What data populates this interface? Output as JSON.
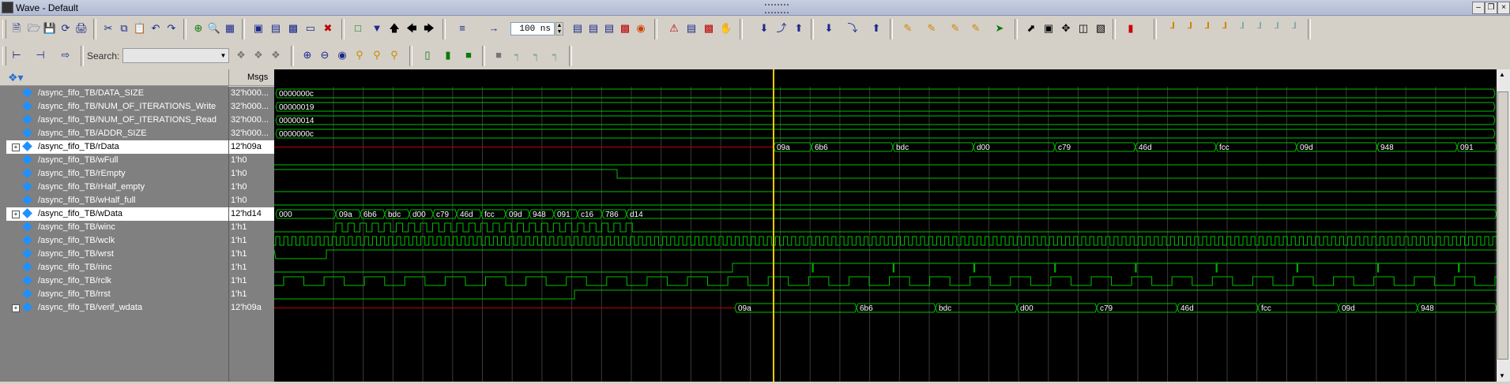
{
  "window": {
    "title": "Wave - Default"
  },
  "toolbar": {
    "zoom_value": "100 ns",
    "search_label": "Search:",
    "search_value": ""
  },
  "pane": {
    "msgs_header": "Msgs"
  },
  "colors": {
    "wave": "#00c000",
    "bus_invalid": "#c00000",
    "cursor": "#ffcc00",
    "highlight": "#ffffff"
  },
  "signals": [
    {
      "name": "/async_fifo_TB/DATA_SIZE",
      "value": "32'h000...",
      "expand": false,
      "highlight": false
    },
    {
      "name": "/async_fifo_TB/NUM_OF_ITERATIONS_Write",
      "value": "32'h000...",
      "expand": false,
      "highlight": false
    },
    {
      "name": "/async_fifo_TB/NUM_OF_ITERATIONS_Read",
      "value": "32'h000...",
      "expand": false,
      "highlight": false
    },
    {
      "name": "/async_fifo_TB/ADDR_SIZE",
      "value": "32'h000...",
      "expand": false,
      "highlight": false
    },
    {
      "name": "/async_fifo_TB/rData",
      "value": "12'h09a",
      "expand": true,
      "highlight": true
    },
    {
      "name": "/async_fifo_TB/wFull",
      "value": "1'h0",
      "expand": false,
      "highlight": false
    },
    {
      "name": "/async_fifo_TB/rEmpty",
      "value": "1'h0",
      "expand": false,
      "highlight": false
    },
    {
      "name": "/async_fifo_TB/rHalf_empty",
      "value": "1'h0",
      "expand": false,
      "highlight": false
    },
    {
      "name": "/async_fifo_TB/wHalf_full",
      "value": "1'h0",
      "expand": false,
      "highlight": false
    },
    {
      "name": "/async_fifo_TB/wData",
      "value": "12'hd14",
      "expand": true,
      "highlight": true
    },
    {
      "name": "/async_fifo_TB/winc",
      "value": "1'h1",
      "expand": false,
      "highlight": false
    },
    {
      "name": "/async_fifo_TB/wclk",
      "value": "1'h1",
      "expand": false,
      "highlight": false
    },
    {
      "name": "/async_fifo_TB/wrst",
      "value": "1'h1",
      "expand": false,
      "highlight": false
    },
    {
      "name": "/async_fifo_TB/rinc",
      "value": "1'h1",
      "expand": false,
      "highlight": false
    },
    {
      "name": "/async_fifo_TB/rclk",
      "value": "1'h1",
      "expand": false,
      "highlight": false
    },
    {
      "name": "/async_fifo_TB/rrst",
      "value": "1'h1",
      "expand": false,
      "highlight": false
    },
    {
      "name": "/async_fifo_TB/verif_wdata",
      "value": "12'h09a",
      "expand": true,
      "highlight": false
    }
  ],
  "bus_values": {
    "DATA_SIZE": [
      "0000000c"
    ],
    "NUM_OF_ITERATIONS_Write": [
      "00000019"
    ],
    "NUM_OF_ITERATIONS_Read": [
      "00000014"
    ],
    "ADDR_SIZE": [
      "0000000c"
    ],
    "rData": [
      "09a",
      "6b6",
      "bdc",
      "d00",
      "c79",
      "46d",
      "fcc",
      "09d",
      "948",
      "091"
    ],
    "wData": [
      "000",
      "09a",
      "6b6",
      "bdc",
      "d00",
      "c79",
      "46d",
      "fcc",
      "09d",
      "948",
      "091",
      "c16",
      "786",
      "d14"
    ],
    "verif_wdata": [
      "09a",
      "6b6",
      "bdc",
      "d00",
      "c79",
      "46d",
      "fcc",
      "09d",
      "948"
    ]
  },
  "icons": {
    "toolbar1": [
      "new-icon",
      "open-icon",
      "save-icon",
      "reload-icon",
      "print-icon",
      "cut-icon",
      "copy-icon",
      "paste-icon",
      "undo-icon",
      "redo-icon",
      "add-icon",
      "find-icon",
      "layout-icon",
      "bookmark-icon",
      "wave-compare-icon",
      "wave-diff-icon",
      "delete-icon",
      "zoom-region-icon",
      "move-up-icon",
      "back-icon",
      "forward-icon",
      "insert-breakpoint-icon",
      "restart-icon",
      "run-icon",
      "break-icon",
      "continue-icon",
      "step-icon",
      "step-over-icon",
      "step-out-icon",
      "edge-icon",
      "cursor-icon",
      "select-icon",
      "zoom-icon",
      "pan-icon",
      "hand-icon"
    ],
    "toolbar2": [
      "divider-add-icon",
      "group-add-icon",
      "expand-icon",
      "search-icon",
      "zoom-in-icon",
      "zoom-out-icon",
      "zoom-full-icon",
      "zoom-cursor-icon",
      "zoom-range-icon",
      "format-literal-icon",
      "format-logic-icon",
      "format-analog-icon"
    ]
  }
}
